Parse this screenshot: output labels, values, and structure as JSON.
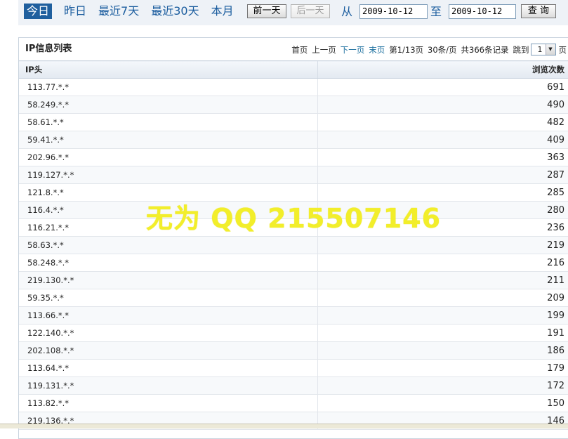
{
  "toolbar": {
    "range_tabs": [
      "今日",
      "昨日",
      "最近7天",
      "最近30天",
      "本月"
    ],
    "prev_day": "前一天",
    "next_day": "后一天",
    "from_label": "从",
    "to_label": "至",
    "date_from": "2009-10-12",
    "date_to": "2009-10-12",
    "query": "查 询"
  },
  "panel": {
    "title": "IP信息列表",
    "pager": {
      "first": "首页",
      "prev": "上一页",
      "next": "下一页",
      "last": "末页",
      "page_info": "第1/13页",
      "per_page": "30条/页",
      "total": "共366条记录",
      "jump_label": "跳到",
      "jump_value": "1",
      "page_unit": "页"
    }
  },
  "table": {
    "columns": [
      "IP头",
      "浏览次数"
    ],
    "rows": [
      [
        "113.77.*.*",
        "691"
      ],
      [
        "58.249.*.*",
        "490"
      ],
      [
        "58.61.*.*",
        "482"
      ],
      [
        "59.41.*.*",
        "409"
      ],
      [
        "202.96.*.*",
        "363"
      ],
      [
        "119.127.*.*",
        "287"
      ],
      [
        "121.8.*.*",
        "285"
      ],
      [
        "116.4.*.*",
        "280"
      ],
      [
        "116.21.*.*",
        "236"
      ],
      [
        "58.63.*.*",
        "219"
      ],
      [
        "58.248.*.*",
        "216"
      ],
      [
        "219.130.*.*",
        "211"
      ],
      [
        "59.35.*.*",
        "209"
      ],
      [
        "113.66.*.*",
        "199"
      ],
      [
        "122.140.*.*",
        "191"
      ],
      [
        "202.108.*.*",
        "186"
      ],
      [
        "113.64.*.*",
        "179"
      ],
      [
        "119.131.*.*",
        "172"
      ],
      [
        "113.82.*.*",
        "150"
      ],
      [
        "219.136.*.*",
        "146"
      ]
    ]
  },
  "watermark": "无为 QQ 215507146",
  "colors": {
    "accent": "#1f5f9e",
    "link": "#1a5c9e",
    "watermark": "#f2ee2a"
  }
}
